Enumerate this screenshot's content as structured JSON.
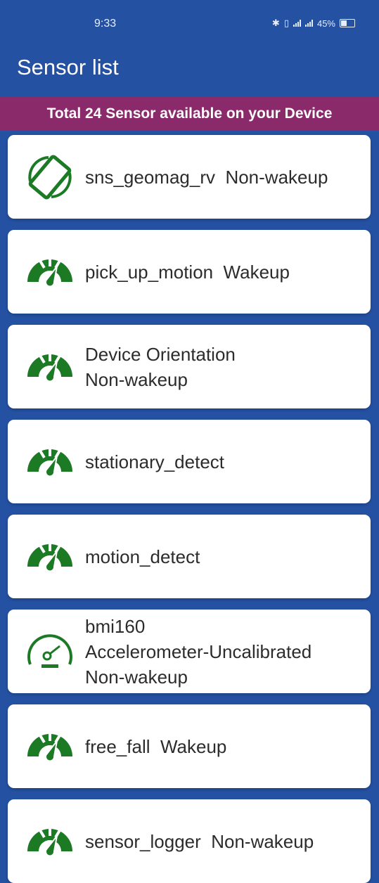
{
  "status_bar": {
    "time": "9:33",
    "battery": "45%"
  },
  "app_bar": {
    "title": "Sensor list"
  },
  "banner": {
    "text": "Total 24 Sensor available on your Device"
  },
  "colors": {
    "header": "#2451a2",
    "banner": "#8b2a6b",
    "icon": "#1c7a25",
    "card": "#ffffff"
  },
  "sensors": [
    {
      "icon": "screen-rotation-icon",
      "lines": [
        "sns_geomag_rv  Non-wakeup"
      ]
    },
    {
      "icon": "speedometer-icon",
      "lines": [
        "pick_up_motion  Wakeup"
      ]
    },
    {
      "icon": "speedometer-icon",
      "lines": [
        "Device Orientation",
        "Non-wakeup"
      ]
    },
    {
      "icon": "speedometer-icon",
      "lines": [
        "stationary_detect"
      ]
    },
    {
      "icon": "speedometer-icon",
      "lines": [
        "motion_detect"
      ]
    },
    {
      "icon": "gauge-outline-icon",
      "lines": [
        "bmi160",
        "Accelerometer-Uncalibrated",
        "Non-wakeup"
      ]
    },
    {
      "icon": "speedometer-icon",
      "lines": [
        "free_fall  Wakeup"
      ]
    },
    {
      "icon": "speedometer-icon",
      "lines": [
        "sensor_logger  Non-wakeup"
      ]
    }
  ]
}
